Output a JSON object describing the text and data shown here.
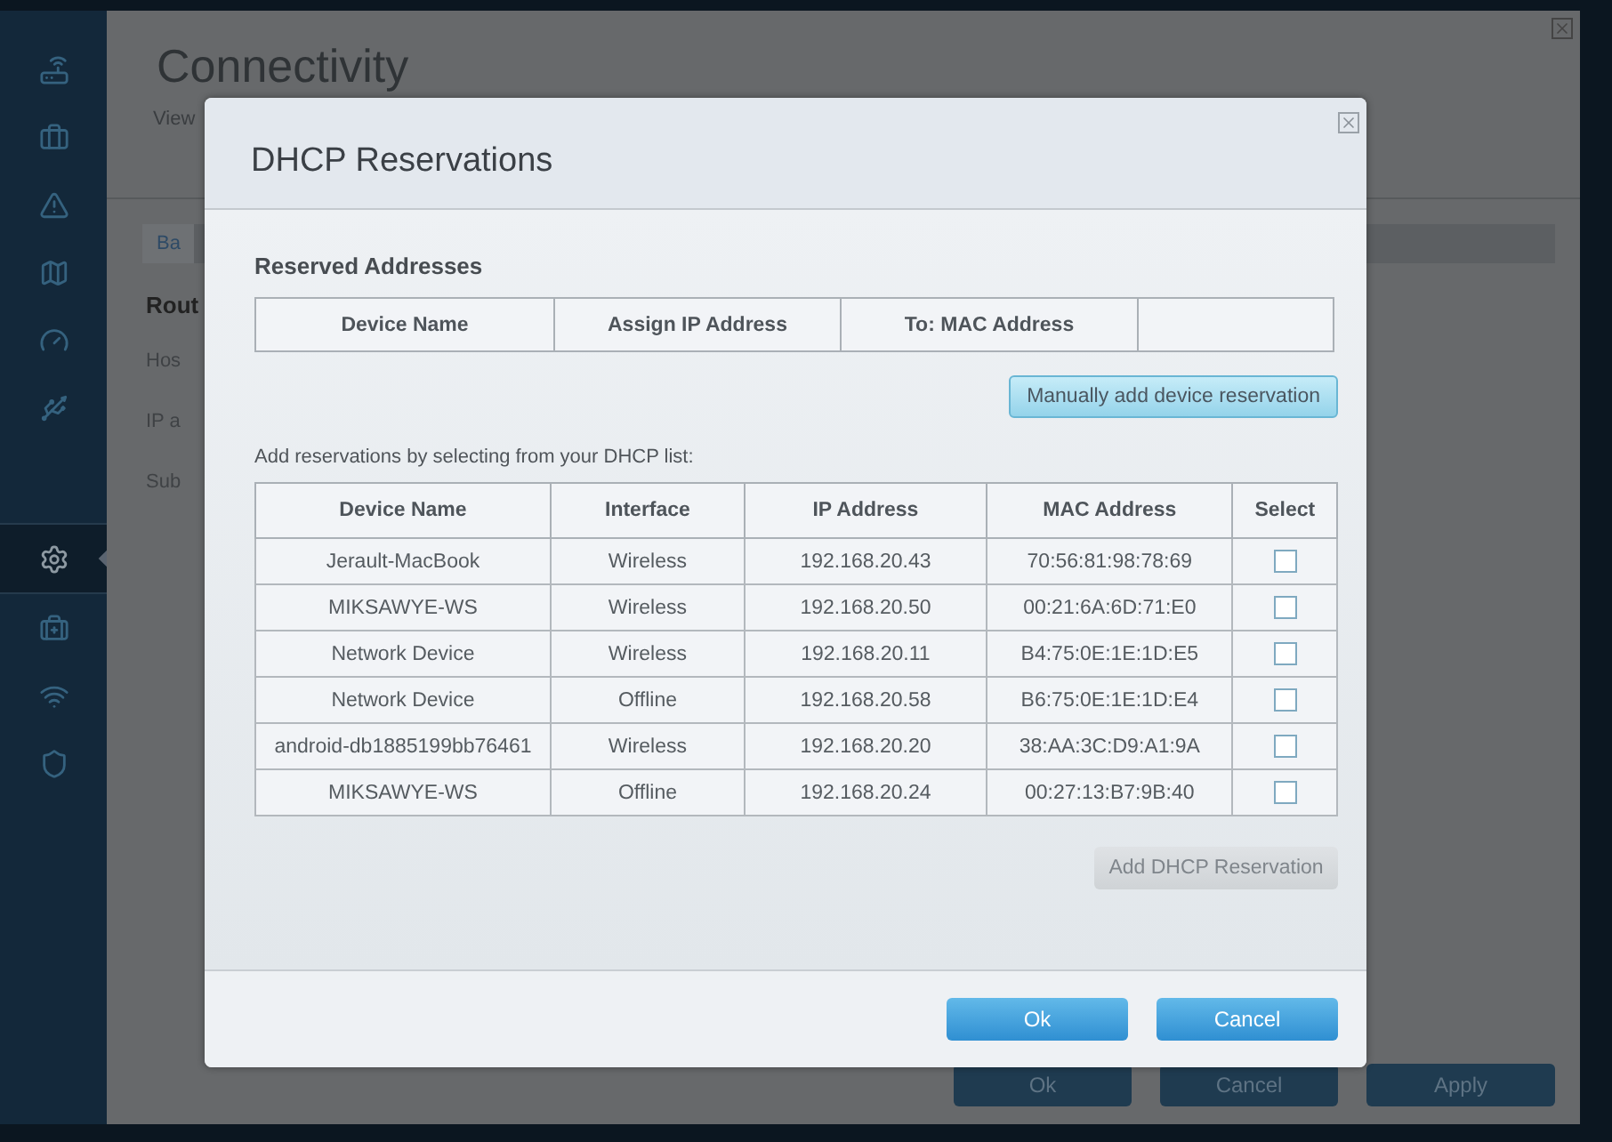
{
  "sidebar": {
    "items": [
      {
        "kind": "router",
        "selected": false
      },
      {
        "kind": "toolbox",
        "selected": false
      },
      {
        "kind": "warning",
        "selected": false
      },
      {
        "kind": "map",
        "selected": false
      },
      {
        "kind": "gauge",
        "selected": false
      },
      {
        "kind": "usb",
        "selected": false
      },
      {
        "kind": "gears",
        "selected": true
      },
      {
        "kind": "medkit",
        "selected": false
      },
      {
        "kind": "wifi",
        "selected": false
      },
      {
        "kind": "shield",
        "selected": false
      }
    ]
  },
  "page": {
    "title": "Connectivity",
    "subtitle": "View",
    "tab": "Ba",
    "section": "Rout",
    "labels": [
      "Hos",
      "IP a",
      "Sub"
    ],
    "buttons": [
      "Ok",
      "Cancel",
      "Apply"
    ]
  },
  "dialog": {
    "title": "DHCP Reservations",
    "reserved": {
      "heading": "Reserved Addresses",
      "columns": [
        "Device Name",
        "Assign IP Address",
        "To: MAC Address"
      ],
      "add_button": "Manually add device reservation"
    },
    "hint": "Add reservations by selecting from your DHCP list:",
    "table": {
      "columns": [
        "Device Name",
        "Interface",
        "IP Address",
        "MAC Address",
        "Select"
      ],
      "rows": [
        {
          "device": "Jerault-MacBook",
          "interface": "Wireless",
          "ip": "192.168.20.43",
          "mac": "70:56:81:98:78:69",
          "checked": false
        },
        {
          "device": "MIKSAWYE-WS",
          "interface": "Wireless",
          "ip": "192.168.20.50",
          "mac": "00:21:6A:6D:71:E0",
          "checked": false
        },
        {
          "device": "Network Device",
          "interface": "Wireless",
          "ip": "192.168.20.11",
          "mac": "B4:75:0E:1E:1D:E5",
          "checked": false
        },
        {
          "device": "Network Device",
          "interface": "Offline",
          "ip": "192.168.20.58",
          "mac": "B6:75:0E:1E:1D:E4",
          "checked": false
        },
        {
          "device": "android-db1885199bb76461",
          "interface": "Wireless",
          "ip": "192.168.20.20",
          "mac": "38:AA:3C:D9:A1:9A",
          "checked": false
        },
        {
          "device": "MIKSAWYE-WS",
          "interface": "Offline",
          "ip": "192.168.20.24",
          "mac": "00:27:13:B7:9B:40",
          "checked": false
        }
      ]
    },
    "add_button": {
      "label": "Add DHCP Reservation",
      "disabled": true
    },
    "buttons": [
      "Ok",
      "Cancel"
    ]
  }
}
